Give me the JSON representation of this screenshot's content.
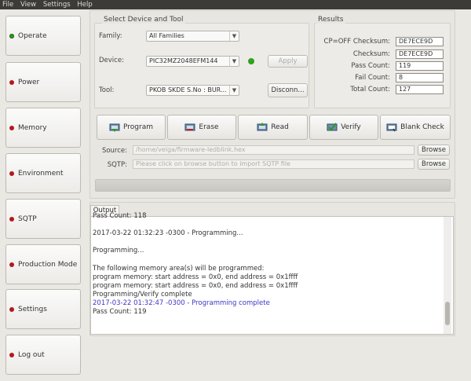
{
  "menubar": {
    "items": [
      "File",
      "View",
      "Settings",
      "Help"
    ]
  },
  "sidebar": {
    "items": [
      {
        "label": "Operate",
        "status": "green"
      },
      {
        "label": "Power",
        "status": "red"
      },
      {
        "label": "Memory",
        "status": "red"
      },
      {
        "label": "Environment",
        "status": "red"
      },
      {
        "label": "SQTP",
        "status": "red"
      },
      {
        "label": "Production Mode",
        "status": "red"
      },
      {
        "label": "Settings",
        "status": "red"
      },
      {
        "label": "Log out",
        "status": "red"
      }
    ]
  },
  "device_panel": {
    "title": "Select Device and Tool",
    "family_label": "Family:",
    "family_value": "All Families",
    "device_label": "Device:",
    "device_value": "PIC32MZ2048EFM144",
    "apply_label": "Apply",
    "tool_label": "Tool:",
    "tool_value": "PKOB SKDE S.No : BUR...",
    "disconnect_label": "Disconn..."
  },
  "results": {
    "title": "Results",
    "rows": [
      {
        "label": "CP=OFF Checksum:",
        "value": "DE7ECE9D"
      },
      {
        "label": "Checksum:",
        "value": "DE7ECE9D"
      },
      {
        "label": "Pass Count:",
        "value": "119"
      },
      {
        "label": "Fail Count:",
        "value": "8"
      },
      {
        "label": "Total Count:",
        "value": "127"
      }
    ]
  },
  "toolbar": {
    "program": "Program",
    "erase": "Erase",
    "read": "Read",
    "verify": "Verify",
    "blank_check": "Blank Check"
  },
  "source": {
    "label": "Source:",
    "value": "/home/velga/firmware-ledblink.hex",
    "browse": "Browse"
  },
  "sqtp": {
    "label": "SQTP:",
    "placeholder": "Please click on browse button to import SQTP file",
    "browse": "Browse"
  },
  "output": {
    "tab": "Output",
    "lines": [
      {
        "text": "Pass Count: 118",
        "color": "normal"
      },
      {
        "text": "",
        "color": "normal"
      },
      {
        "text": "2017-03-22 01:32:23 -0300 - Programming...",
        "color": "normal"
      },
      {
        "text": "",
        "color": "normal"
      },
      {
        "text": "Programming...",
        "color": "normal"
      },
      {
        "text": "",
        "color": "normal"
      },
      {
        "text": "The following memory area(s) will be programmed:",
        "color": "normal"
      },
      {
        "text": "program memory: start address = 0x0, end address = 0x1ffff",
        "color": "normal"
      },
      {
        "text": "program memory: start address = 0x0, end address = 0x1ffff",
        "color": "normal"
      },
      {
        "text": "Programming/Verify complete",
        "color": "normal"
      },
      {
        "text": "2017-03-22 01:32:47 -0300 - Programming complete",
        "color": "blue"
      },
      {
        "text": "Pass Count: 119",
        "color": "normal"
      }
    ]
  }
}
